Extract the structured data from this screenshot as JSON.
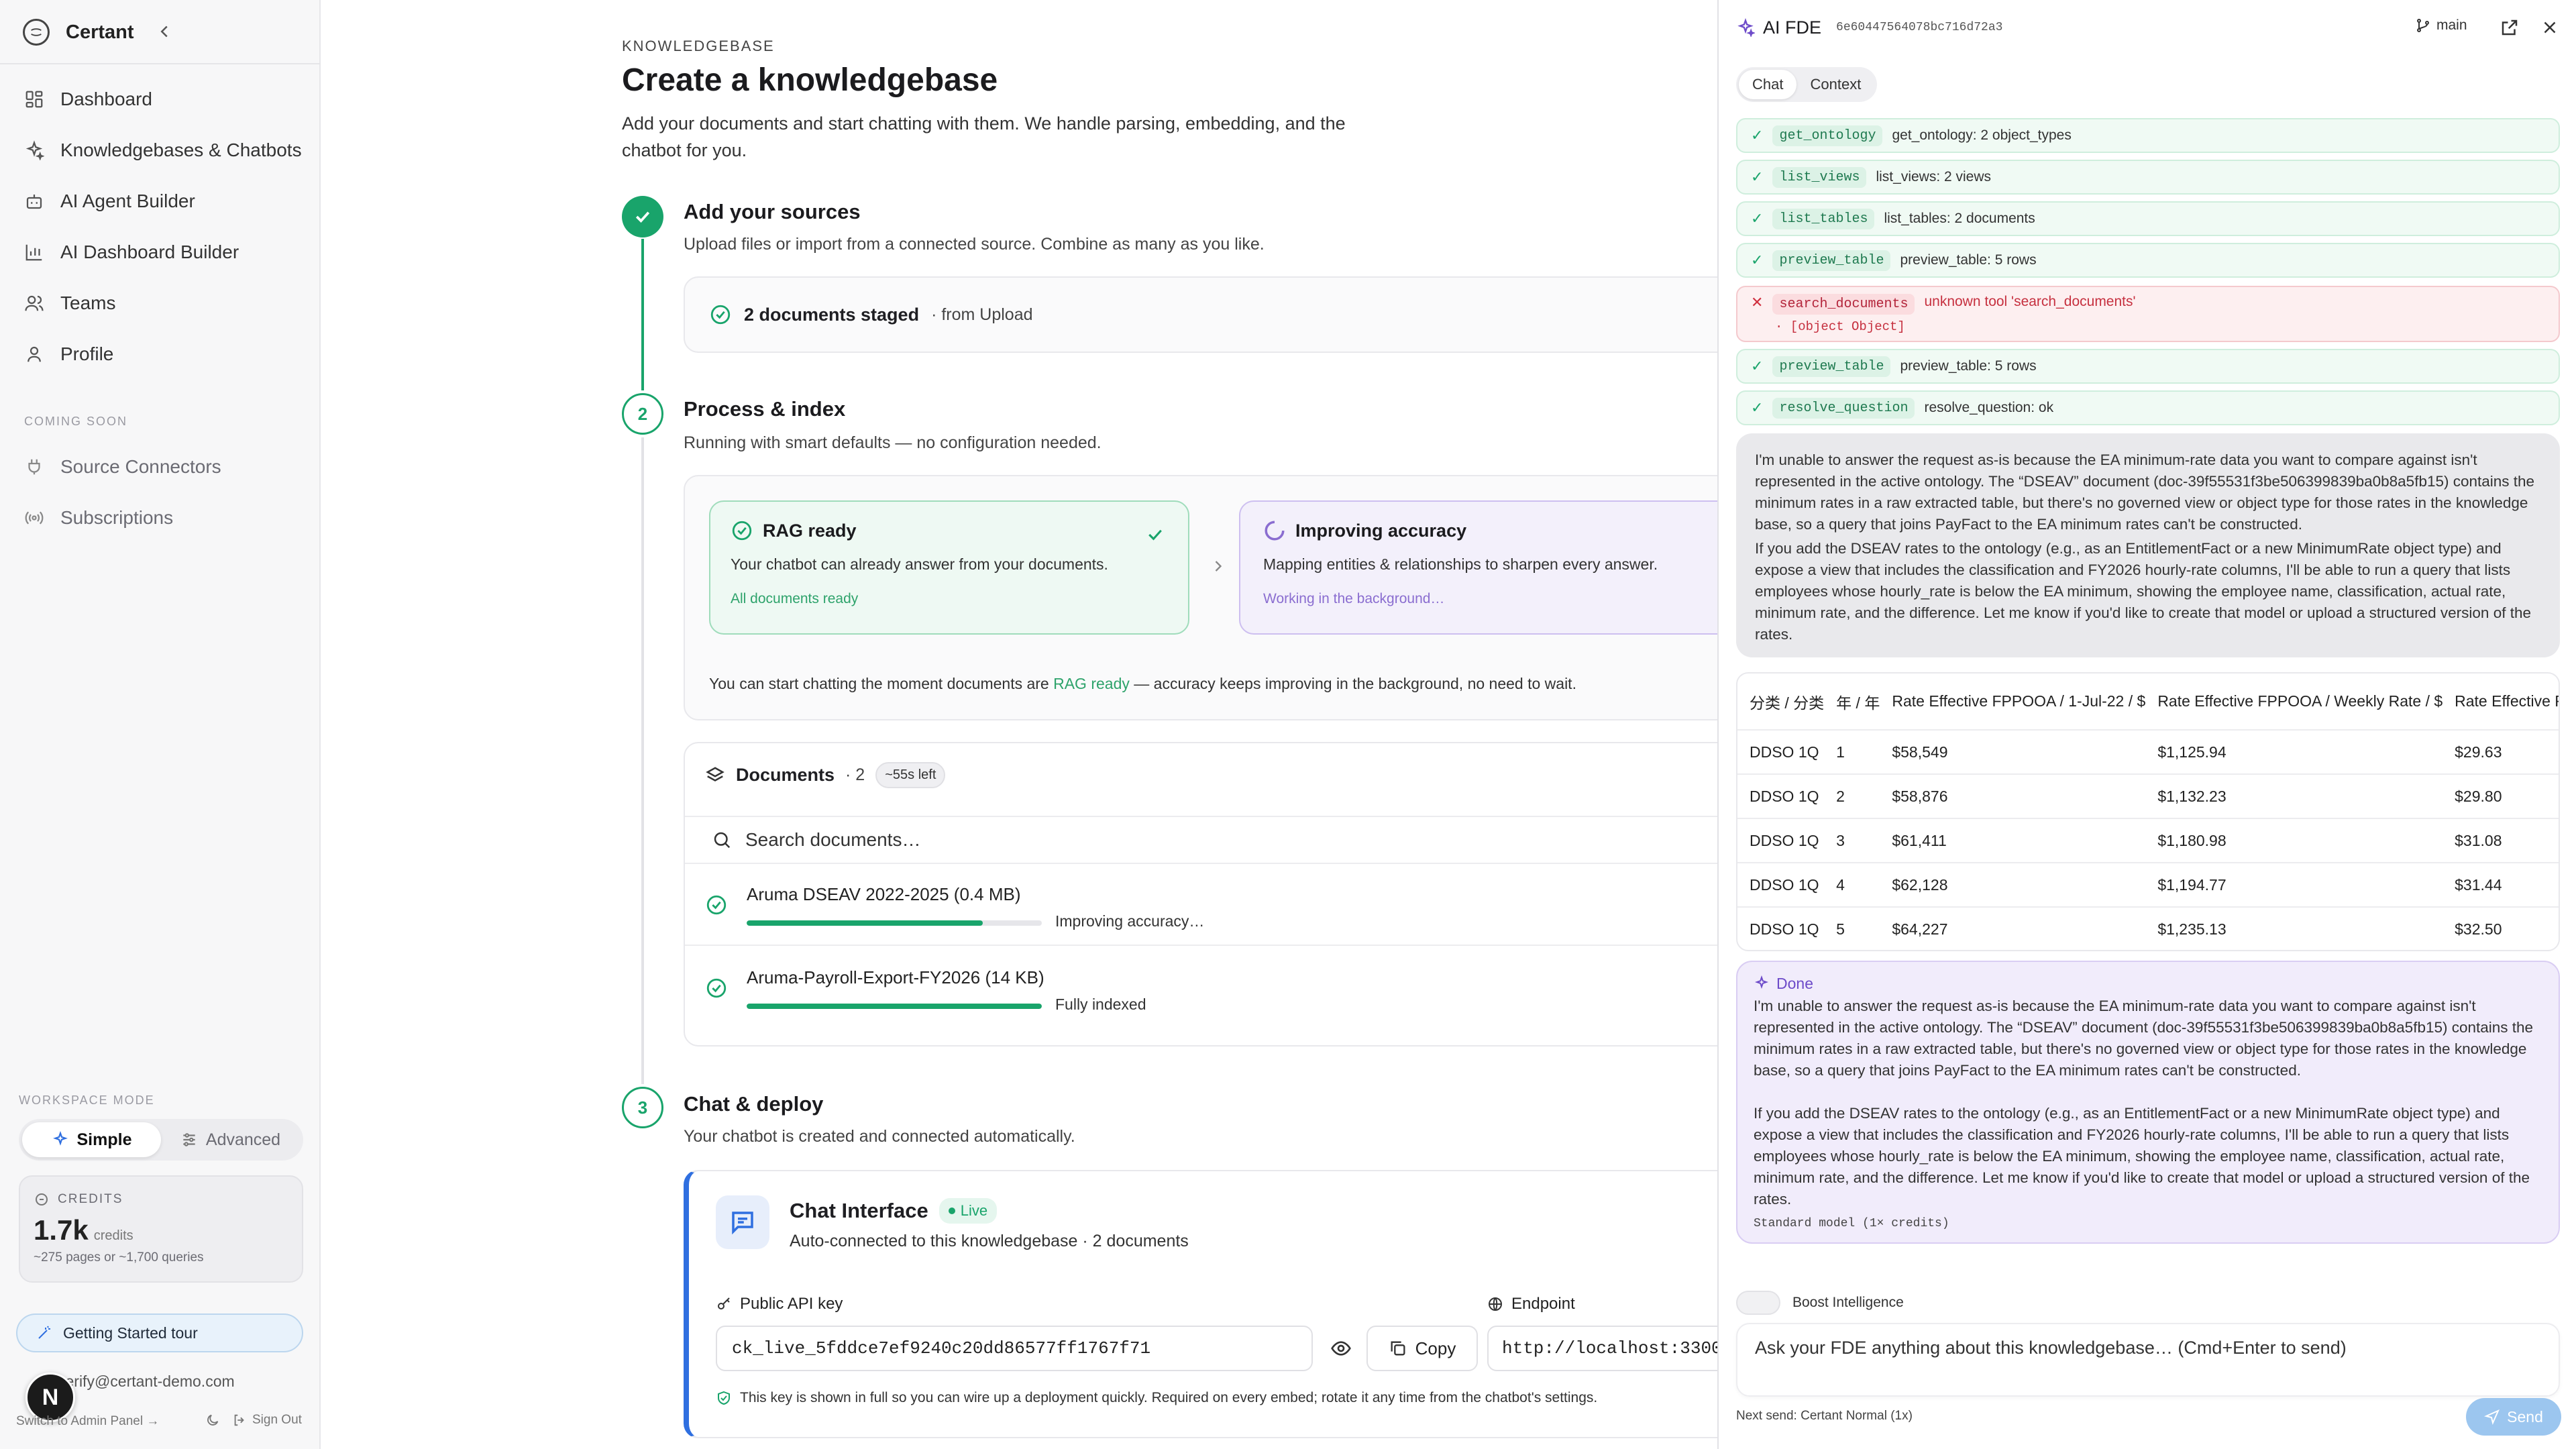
{
  "sidebar": {
    "brand": "Certant",
    "nav": [
      {
        "label": "Dashboard",
        "icon": "dashboard-icon"
      },
      {
        "label": "Knowledgebases & Chatbots",
        "icon": "sparkles-icon"
      },
      {
        "label": "AI Agent Builder",
        "icon": "bot-icon"
      },
      {
        "label": "AI Dashboard Builder",
        "icon": "bar-chart-icon"
      },
      {
        "label": "Teams",
        "icon": "users-icon"
      },
      {
        "label": "Profile",
        "icon": "user-icon"
      }
    ],
    "coming_soon_label": "COMING SOON",
    "coming_soon": [
      {
        "label": "Source Connectors",
        "icon": "plug-icon"
      },
      {
        "label": "Subscriptions",
        "icon": "broadcast-icon"
      }
    ],
    "workspace_mode_label": "WORKSPACE MODE",
    "mode_simple": "Simple",
    "mode_advanced": "Advanced",
    "credits_label": "CREDITS",
    "credits_value": "1.7k",
    "credits_unit": "credits",
    "credits_sub": "~275 pages or ~1,700 queries",
    "tour": "Getting Started tour",
    "user_email": "verify@certant-demo.com",
    "avatar_letter": "N",
    "admin_link": "Switch to Admin Panel →",
    "sign_out": "Sign Out"
  },
  "main": {
    "breadcrumb": "KNOWLEDGEBASE",
    "title": "Create a knowledgebase",
    "lead": "Add your documents and start chatting with them. We handle parsing, embedding, and the chatbot for you.",
    "step1": {
      "title": "Add your sources",
      "sub": "Upload files or import from a connected source. Combine as many as you like.",
      "staged": "2 documents staged",
      "staged_from": "· from Upload"
    },
    "step2": {
      "num": "2",
      "title": "Process & index",
      "sub": "Running with smart defaults — no configuration needed.",
      "rag_title": "RAG ready",
      "rag_desc": "Your chatbot can already answer from your documents.",
      "rag_foot": "All documents ready",
      "imp_title": "Improving accuracy",
      "imp_desc": "Mapping entities & relationships to sharpen every answer.",
      "imp_foot": "Working in the background…",
      "note_pre": "You can start chatting the moment documents are ",
      "note_link": "RAG ready",
      "note_post": " — accuracy keeps improving in the background, no need to wait."
    },
    "documents": {
      "title": "Documents",
      "count": "· 2",
      "time_left": "~55s left",
      "search_placeholder": "Search documents…",
      "rows": [
        {
          "name": "Aruma DSEAV 2022-2025 (0.4 MB)",
          "status": "Improving accuracy…",
          "progress": 0.8
        },
        {
          "name": "Aruma-Payroll-Export-FY2026 (14 KB)",
          "status": "Fully indexed",
          "progress": 1.0
        }
      ]
    },
    "step3": {
      "num": "3",
      "title": "Chat & deploy",
      "sub": "Your chatbot is created and connected automatically.",
      "chat_title": "Chat Interface",
      "live": "Live",
      "chat_sub": "Auto-connected to this knowledgebase · 2 documents",
      "api_label": "Public API key",
      "api_key": "ck_live_5fddce7ef9240c20dd86577ff1767f71",
      "copy": "Copy",
      "endpoint_label": "Endpoint",
      "endpoint": "http://localhost:3300",
      "key_note": "This key is shown in full so you can wire up a deployment quickly. Required on every embed; rotate it any time from the chatbot's settings."
    }
  },
  "fde": {
    "title": "AI FDE",
    "id": "6e60447564078bc716d72a3",
    "branch": "main",
    "tabs": [
      "Chat",
      "Context"
    ],
    "tools": [
      {
        "code": "get_ontology",
        "text": "get_ontology: 2 object_types",
        "status": "ok"
      },
      {
        "code": "list_views",
        "text": "list_views: 2 views",
        "status": "ok"
      },
      {
        "code": "list_tables",
        "text": "list_tables: 2 documents",
        "status": "ok"
      },
      {
        "code": "preview_table",
        "text": "preview_table: 5 rows",
        "status": "ok"
      },
      {
        "code": "search_documents",
        "text": "unknown tool 'search_documents'",
        "detail": "· [object Object]",
        "status": "error"
      },
      {
        "code": "preview_table",
        "text": "preview_table: 5 rows",
        "status": "ok"
      },
      {
        "code": "resolve_question",
        "text": "resolve_question: ok",
        "status": "ok"
      }
    ],
    "grey_p1": "I'm unable to answer the request as-is because the EA minimum-rate data you want to compare against isn't represented in the active ontology. The “DSEAV” document (doc-39f55531f3be506399839ba0b8a5fb15) contains the minimum rates in a raw extracted table, but there's no governed view or object type for those rates in the knowledge base, so a query that joins PayFact to the EA minimum rates can't be constructed.",
    "grey_p2": "If you add the DSEAV rates to the ontology (e.g., as an EntitlementFact or a new MinimumRate object type) and expose a view that includes the classification and FY2026 hourly-rate columns, I'll be able to run a query that lists employees whose hourly_rate is below the EA minimum, showing the employee name, classification, actual rate, minimum rate, and the difference. Let me know if you'd like to create that model or upload a structured version of the rates.",
    "table": {
      "headers": [
        "分类 / 分类",
        "年 / 年",
        "Rate Effective FPPOOA / 1-Jul-22 / $",
        "Rate Effective FPPOOA / Weekly Rate / $",
        "Rate Effective FPPOOA / Hourly Rate / $"
      ],
      "rows": [
        [
          "DDSO 1Q",
          "1",
          "$58,549",
          "$1,125.94",
          "$29.63"
        ],
        [
          "DDSO 1Q",
          "2",
          "$58,876",
          "$1,132.23",
          "$29.80"
        ],
        [
          "DDSO 1Q",
          "3",
          "$61,411",
          "$1,180.98",
          "$31.08"
        ],
        [
          "DDSO 1Q",
          "4",
          "$62,128",
          "$1,194.77",
          "$31.44"
        ],
        [
          "DDSO 1Q",
          "5",
          "$64,227",
          "$1,235.13",
          "$32.50"
        ]
      ]
    },
    "done_label": "Done",
    "done_p1": "I'm unable to answer the request as-is because the EA minimum-rate data you want to compare against isn't represented in the active ontology. The “DSEAV” document (doc-39f55531f3be506399839ba0b8a5fb15) contains the minimum rates in a raw extracted table, but there's no governed view or object type for those rates in the knowledge base, so a query that joins PayFact to the EA minimum rates can't be constructed.",
    "done_p2": "If you add the DSEAV rates to the ontology (e.g., as an EntitlementFact or a new MinimumRate object type) and expose a view that includes the classification and FY2026 hourly-rate columns, I'll be able to run a query that lists employees whose hourly_rate is below the EA minimum, showing the employee name, classification, actual rate, minimum rate, and the difference. Let me know if you'd like to create that model or upload a structured version of the rates.",
    "done_foot": "Standard model (1× credits)",
    "boost": "Boost Intelligence",
    "input_placeholder": "Ask your FDE anything about this knowledgebase…  (Cmd+Enter to send)",
    "next_send": "Next send: Certant Normal (1x)",
    "send": "Send"
  },
  "colors": {
    "accent_green": "#19a46b",
    "accent_blue": "#2f6fe0",
    "accent_purple": "#6d4bc9",
    "error_red": "#c6303f"
  }
}
